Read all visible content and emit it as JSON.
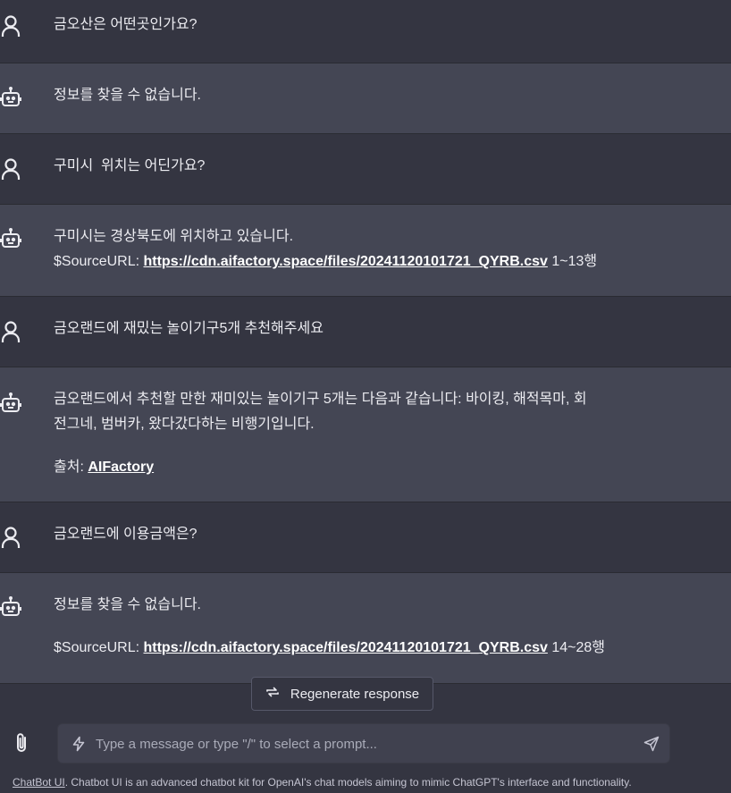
{
  "messages": [
    {
      "role": "user",
      "lines": [
        "금오산은 어떤곳인가요?"
      ]
    },
    {
      "role": "bot",
      "lines": [
        "정보를 찾을 수 없습니다."
      ]
    },
    {
      "role": "user",
      "lines": [
        "구미시  위치는 어딘가요?"
      ]
    },
    {
      "role": "bot",
      "lines": [
        "구미시는 경상북도에 위치하고 있습니다."
      ],
      "source": {
        "prefix": "$SourceURL: ",
        "url": "https://cdn.aifactory.space/files/20241120101721_QYRB.csv",
        "suffix": " 1~13행"
      }
    },
    {
      "role": "user",
      "lines": [
        "금오랜드에 재밌는 놀이기구5개 추천해주세요"
      ]
    },
    {
      "role": "bot",
      "lines": [
        "금오랜드에서 추천할 만한 재미있는 놀이기구 5개는 다음과 같습니다: 바이킹, 해적목마, 회",
        "전그네, 범버카, 왔다갔다하는 비행기입니다."
      ],
      "citation": {
        "prefix": "출처: ",
        "link": "AIFactory"
      }
    },
    {
      "role": "user",
      "lines": [
        "금오랜드에 이용금액은?"
      ]
    },
    {
      "role": "bot",
      "lines": [
        "정보를 찾을 수 없습니다."
      ],
      "source": {
        "prefix": "$SourceURL: ",
        "url": "https://cdn.aifactory.space/files/20241120101721_QYRB.csv",
        "suffix": " 14~28행"
      }
    }
  ],
  "regenerate_label": "Regenerate response",
  "input": {
    "placeholder": "Type a message or type \"/\" to select a prompt...",
    "value": ""
  },
  "footer": {
    "link": "ChatBot UI",
    "text": ". Chatbot UI is an advanced chatbot kit for OpenAI's chat models aiming to mimic ChatGPT's interface and functionality."
  },
  "icons": {
    "user": "user-icon",
    "bot": "robot-icon",
    "regenerate": "refresh-icon",
    "attach": "paperclip-icon",
    "prompt": "lightning-icon",
    "send": "send-icon"
  }
}
